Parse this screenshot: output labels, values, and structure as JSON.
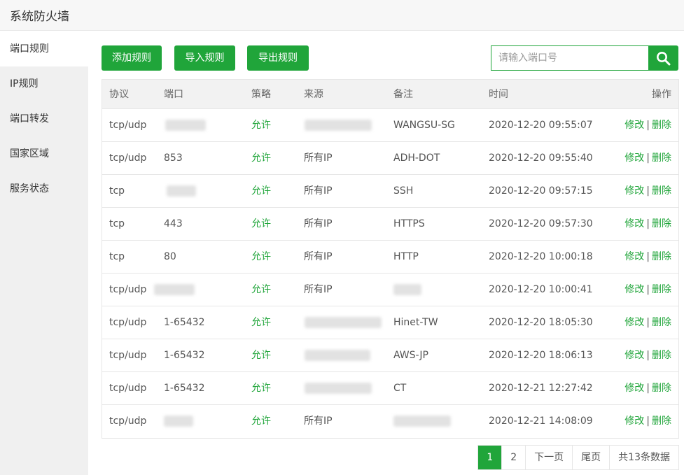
{
  "window": {
    "title": "系统防火墙"
  },
  "sidebar": {
    "items": [
      {
        "label": "端口规则",
        "active": true
      },
      {
        "label": "IP规则",
        "active": false
      },
      {
        "label": "端口转发",
        "active": false
      },
      {
        "label": "国家区域",
        "active": false
      },
      {
        "label": "服务状态",
        "active": false
      }
    ]
  },
  "toolbar": {
    "add_label": "添加规则",
    "import_label": "导入规则",
    "export_label": "导出规则",
    "search_placeholder": "请输入端口号",
    "search_value": ""
  },
  "table": {
    "headers": {
      "protocol": "协议",
      "port": "端口",
      "policy": "策略",
      "source": "来源",
      "note": "备注",
      "time": "时间",
      "ops": "操作"
    },
    "rows": [
      {
        "protocol": "tcp/udp",
        "port": "",
        "policy": "允许",
        "source": "",
        "note": "WANGSU-SG",
        "time": "2020-12-20 09:55:07"
      },
      {
        "protocol": "tcp/udp",
        "port": "853",
        "policy": "允许",
        "source": "所有IP",
        "note": "ADH-DOT",
        "time": "2020-12-20 09:55:40"
      },
      {
        "protocol": "tcp",
        "port": "",
        "policy": "允许",
        "source": "所有IP",
        "note": "SSH",
        "time": "2020-12-20 09:57:15"
      },
      {
        "protocol": "tcp",
        "port": "443",
        "policy": "允许",
        "source": "所有IP",
        "note": "HTTPS",
        "time": "2020-12-20 09:57:30"
      },
      {
        "protocol": "tcp",
        "port": "80",
        "policy": "允许",
        "source": "所有IP",
        "note": "HTTP",
        "time": "2020-12-20 10:00:18"
      },
      {
        "protocol": "tcp/udp",
        "port": "",
        "policy": "允许",
        "source": "所有IP",
        "note": "",
        "time": "2020-12-20 10:00:41"
      },
      {
        "protocol": "tcp/udp",
        "port": "1-65432",
        "policy": "允许",
        "source": "",
        "note": "Hinet-TW",
        "time": "2020-12-20 18:05:30"
      },
      {
        "protocol": "tcp/udp",
        "port": "1-65432",
        "policy": "允许",
        "source": "",
        "note": "AWS-JP",
        "time": "2020-12-20 18:06:13"
      },
      {
        "protocol": "tcp/udp",
        "port": "1-65432",
        "policy": "允许",
        "source": "",
        "note": "CT",
        "time": "2020-12-21 12:27:42"
      },
      {
        "protocol": "tcp/udp",
        "port": "",
        "policy": "允许",
        "source": "所有IP",
        "note": "",
        "time": "2020-12-21 14:08:09"
      }
    ],
    "op_edit": "修改",
    "op_sep": "|",
    "op_delete": "删除"
  },
  "pagination": {
    "pages": [
      "1",
      "2"
    ],
    "current": "1",
    "next_label": "下一页",
    "last_label": "尾页",
    "total_label": "共13条数据"
  },
  "colors": {
    "accent": "#20a53a"
  }
}
